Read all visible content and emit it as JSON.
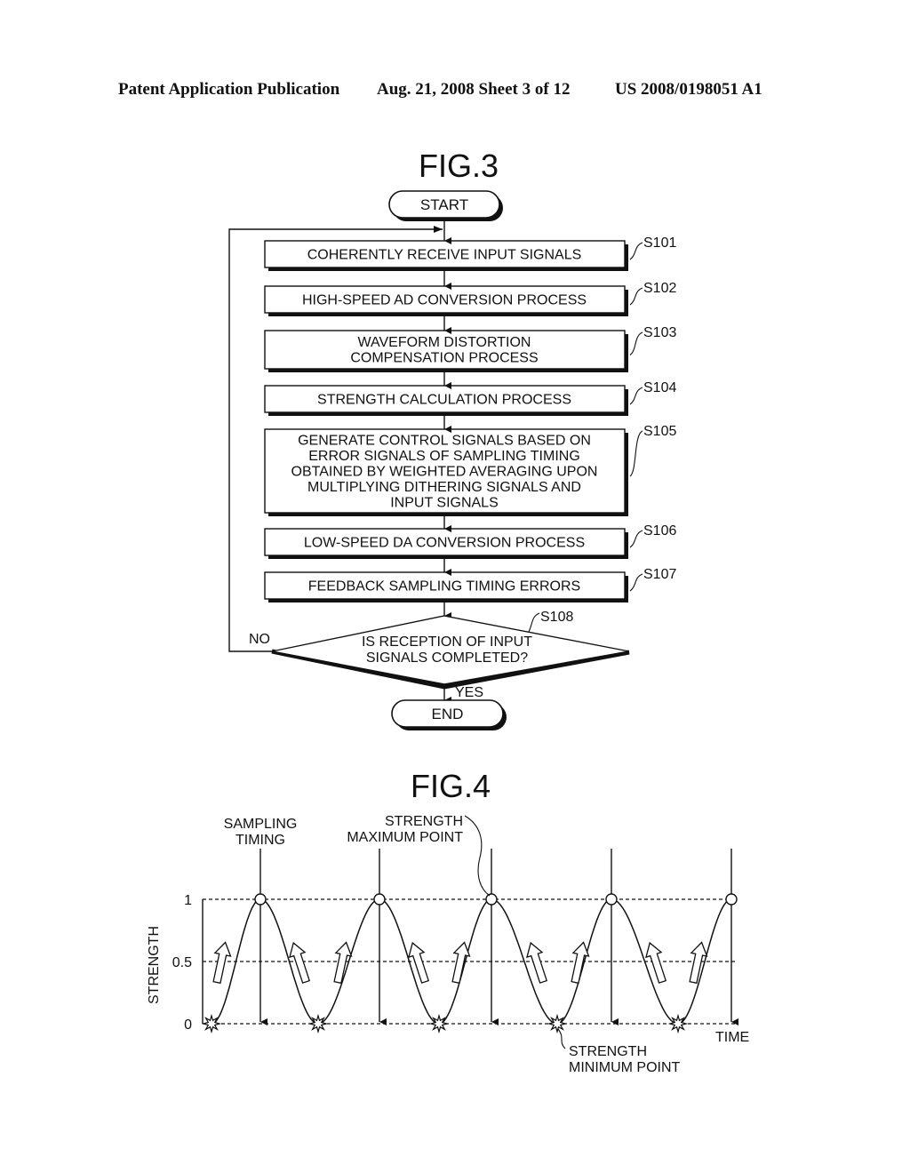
{
  "header": {
    "publication": "Patent Application Publication",
    "date_sheet": "Aug. 21, 2008  Sheet 3 of 12",
    "number": "US 2008/0198051 A1"
  },
  "fig3": {
    "title": "FIG.3",
    "start": "START",
    "end": "END",
    "steps": [
      {
        "id": "S101",
        "lines": [
          "COHERENTLY RECEIVE INPUT SIGNALS"
        ]
      },
      {
        "id": "S102",
        "lines": [
          "HIGH-SPEED AD CONVERSION PROCESS"
        ]
      },
      {
        "id": "S103",
        "lines": [
          "WAVEFORM DISTORTION",
          "COMPENSATION PROCESS"
        ]
      },
      {
        "id": "S104",
        "lines": [
          "STRENGTH CALCULATION PROCESS"
        ]
      },
      {
        "id": "S105",
        "lines": [
          "GENERATE CONTROL SIGNALS BASED ON",
          "ERROR SIGNALS OF SAMPLING TIMING",
          "OBTAINED BY WEIGHTED AVERAGING UPON",
          "MULTIPLYING DITHERING SIGNALS AND",
          "INPUT SIGNALS"
        ]
      },
      {
        "id": "S106",
        "lines": [
          "LOW-SPEED DA CONVERSION PROCESS"
        ]
      },
      {
        "id": "S107",
        "lines": [
          "FEEDBACK SAMPLING TIMING ERRORS"
        ]
      }
    ],
    "decision": {
      "id": "S108",
      "lines": [
        "IS RECEPTION OF INPUT",
        "SIGNALS COMPLETED?"
      ],
      "no_label": "NO",
      "yes_label": "YES"
    }
  },
  "fig4": {
    "title": "FIG.4",
    "ylabel": "STRENGTH",
    "xlabel": "TIME",
    "yticks": [
      "1",
      "0.5",
      "0"
    ],
    "annotations": {
      "sampling_timing": [
        "SAMPLING",
        "TIMING"
      ],
      "max_point": [
        "STRENGTH",
        "MAXIMUM POINT"
      ],
      "min_point": [
        "STRENGTH",
        "MINIMUM POINT"
      ]
    }
  },
  "chart_data": {
    "type": "line",
    "title": "FIG.4",
    "xlabel": "TIME",
    "ylabel": "STRENGTH",
    "ylim": [
      0,
      1
    ],
    "yticks": [
      0,
      0.5,
      1
    ],
    "grid": "dashed horizontal at 0, 0.5, 1",
    "series": [
      {
        "name": "strength",
        "description": "periodic waveform oscillating between 0 and 1",
        "peaks": 5,
        "minima": 5
      }
    ],
    "sampling_timings": 5,
    "sampling_timing_strength": 1,
    "strength_maximum": 1,
    "strength_minimum": 0
  }
}
